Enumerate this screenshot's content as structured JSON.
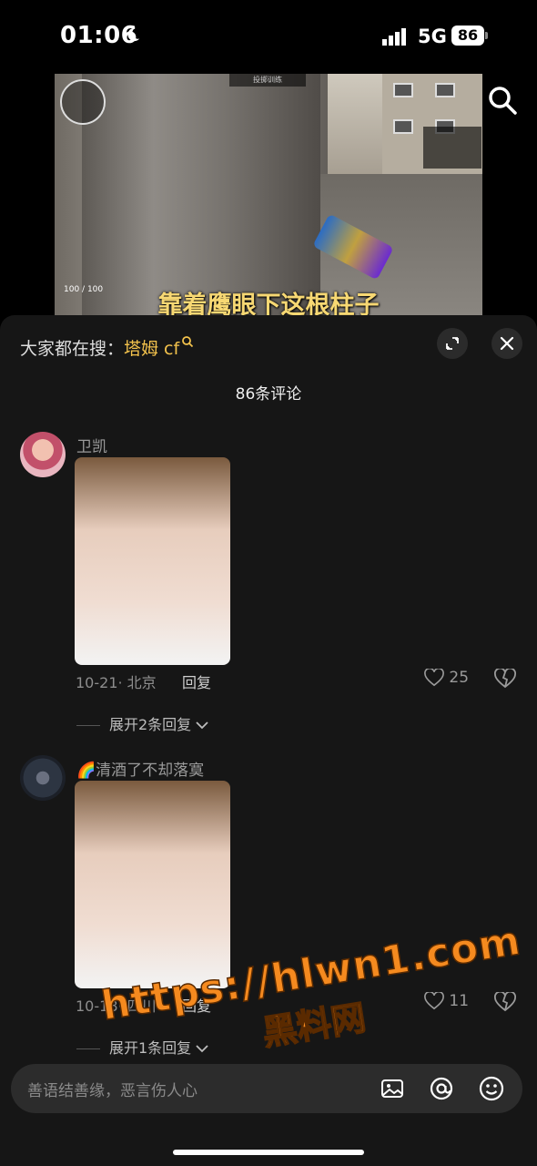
{
  "status_bar": {
    "time": "01:06",
    "network": "5G",
    "battery": "86"
  },
  "video": {
    "subtitle": "靠着鹰眼下这根柱子",
    "hud_top": "投掷训练",
    "hud_hp": "100",
    "hud_armor": "100"
  },
  "search_banner": {
    "prefix": "大家都在搜：",
    "keyword": "塔姆 cf"
  },
  "comments_header": {
    "count_label": "86条评论"
  },
  "comments": [
    {
      "username": "卫凯",
      "date": "10-21",
      "location": "北京",
      "reply_label": "回复",
      "likes": "25",
      "expand_label": "展开2条回复"
    },
    {
      "username": "🌈清酒了不却落寞",
      "date": "10-18",
      "location": "四川",
      "reply_label": "回复",
      "likes": "11",
      "expand_label": "展开1条回复"
    }
  ],
  "input": {
    "placeholder": "善语结善缘，恶言伤人心"
  },
  "watermark": {
    "line1": "https://hlwn1.com",
    "line2": "黑料网"
  },
  "colors": {
    "background": "#161616",
    "keyword": "#f3c24c",
    "subtitle": "#f7d873",
    "watermark": "#f58a1f"
  }
}
